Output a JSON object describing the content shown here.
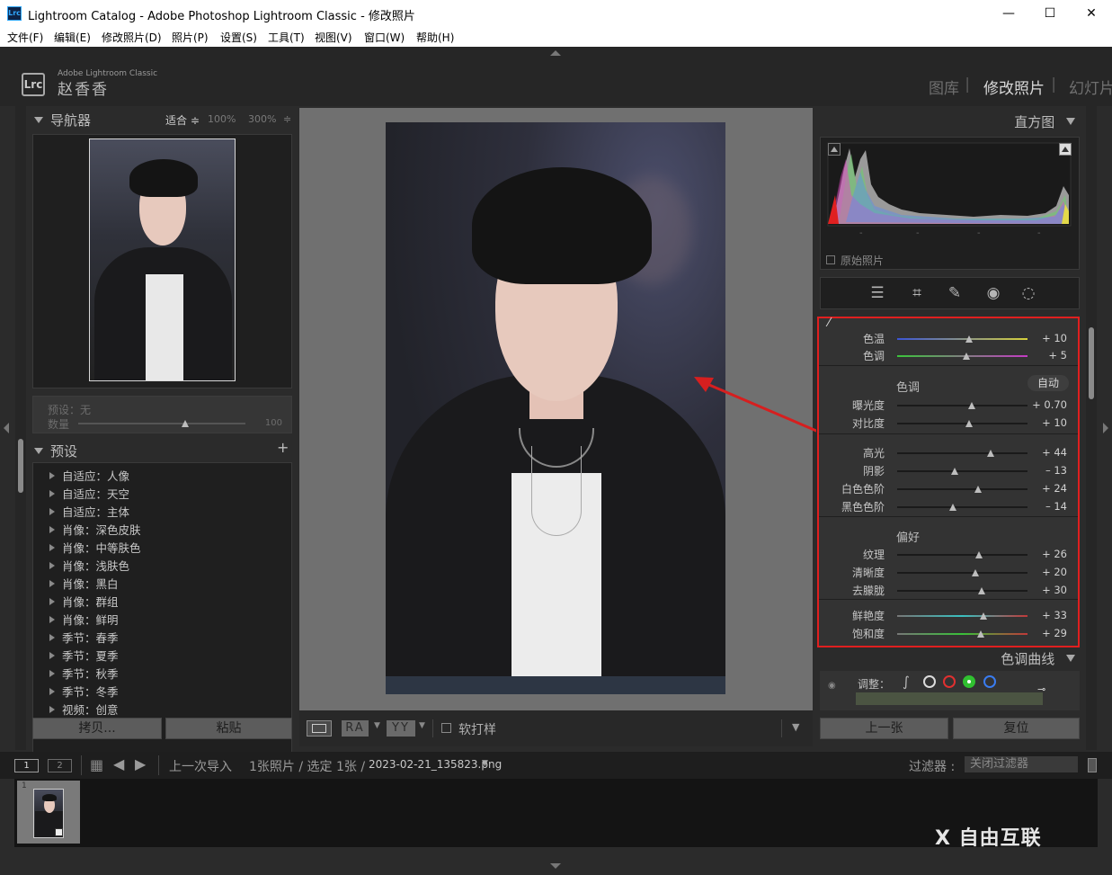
{
  "window": {
    "app_icon": "Lrc",
    "title": "Lightroom Catalog - Adobe Photoshop Lightroom Classic - 修改照片",
    "minimize": "—",
    "maximize": "☐",
    "close": "✕"
  },
  "menu": [
    "文件(F)",
    "编辑(E)",
    "修改照片(D)",
    "照片(P)",
    "设置(S)",
    "工具(T)",
    "视图(V)",
    "窗口(W)",
    "帮助(H)"
  ],
  "identity": {
    "logo": "Lrc",
    "product": "Adobe Lightroom Classic",
    "user": "赵香香"
  },
  "modules": {
    "library": "图库",
    "develop": "修改照片",
    "slideshow": "幻灯片",
    "sep": "|"
  },
  "navigator": {
    "title": "导航器",
    "fit": "适合 ≑",
    "z100": "100%",
    "z300": "300%",
    "more": "≑"
  },
  "preset_amount": {
    "preset_label": "预设：无",
    "amount_label": "数量",
    "amount_value": "100",
    "amount_level": 0.64
  },
  "presets": {
    "title": "预设",
    "add": "+",
    "items": [
      "自适应：人像",
      "自适应：天空",
      "自适应：主体",
      "肖像：深色皮肤",
      "肖像：中等肤色",
      "肖像：浅肤色",
      "肖像：黑白",
      "肖像：群组",
      "肖像：鲜明",
      "季节：春季",
      "季节：夏季",
      "季节：秋季",
      "季节：冬季",
      "视频：创意"
    ]
  },
  "left_buttons": {
    "copy": "拷贝...",
    "paste": "粘贴"
  },
  "toolbar": {
    "ra": "RA",
    "yy": "YY",
    "softproof": "软打样"
  },
  "histogram": {
    "title": "直方图",
    "original": "原始照片",
    "ticks": [
      "-",
      "-",
      "-",
      "-"
    ]
  },
  "basic": {
    "wb": [
      {
        "label": "色温",
        "value": "+ 10",
        "level": 0.55
      },
      {
        "label": "色调",
        "value": "+ 5",
        "level": 0.53
      }
    ],
    "tone_title": "色调",
    "auto": "自动",
    "tone": [
      {
        "label": "曝光度",
        "value": "+ 0.70",
        "level": 0.57
      },
      {
        "label": "对比度",
        "value": "+ 10",
        "level": 0.55
      }
    ],
    "tone2": [
      {
        "label": "高光",
        "value": "+ 44",
        "level": 0.72
      },
      {
        "label": "阴影",
        "value": "– 13",
        "level": 0.44
      },
      {
        "label": "白色色阶",
        "value": "+ 24",
        "level": 0.62
      },
      {
        "label": "黑色色阶",
        "value": "– 14",
        "level": 0.43
      }
    ],
    "presence_title": "偏好",
    "presence": [
      {
        "label": "纹理",
        "value": "+ 26",
        "level": 0.63
      },
      {
        "label": "清晰度",
        "value": "+ 20",
        "level": 0.6
      },
      {
        "label": "去朦胧",
        "value": "+ 30",
        "level": 0.65
      }
    ],
    "presence2": [
      {
        "label": "鲜艳度",
        "value": "+ 33",
        "level": 0.66
      },
      {
        "label": "饱和度",
        "value": "+ 29",
        "level": 0.64
      }
    ]
  },
  "tone_curve": {
    "title": "色调曲线",
    "adjust": "调整："
  },
  "right_buttons": {
    "prev": "上一张",
    "reset": "复位"
  },
  "filmstrip_bar": {
    "screen1": "1",
    "screen2": "2",
    "source": "上一次导入",
    "count": "1张照片 / 选定 1张 /",
    "filename": "2023-02-21_135823.png",
    "filter_label": "过滤器 :",
    "filter_value": "关闭过滤器"
  },
  "filmstrip": {
    "index": "1"
  },
  "watermark": "X 自由互联"
}
